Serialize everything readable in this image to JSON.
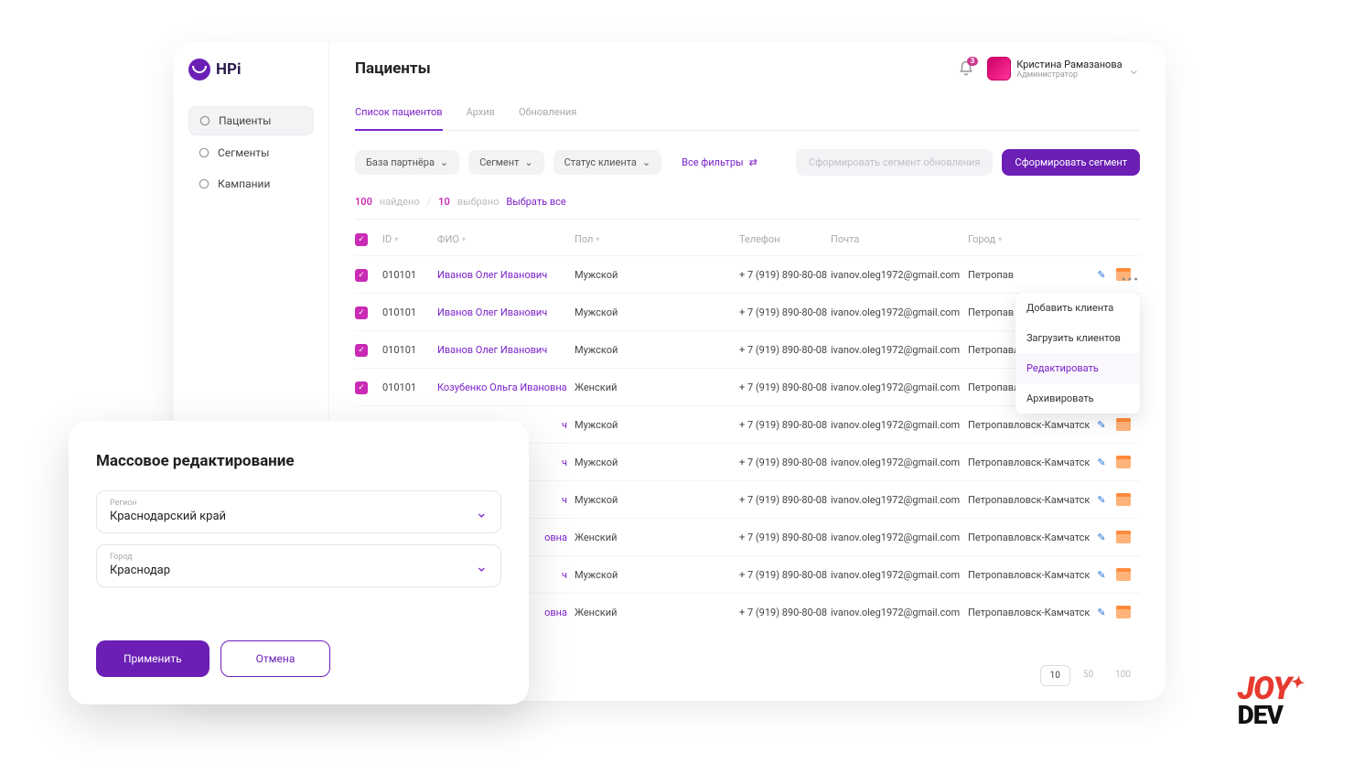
{
  "brand": "HPi",
  "sidebar": {
    "items": [
      {
        "label": "Пациенты",
        "active": true
      },
      {
        "label": "Сегменты",
        "active": false
      },
      {
        "label": "Кампании",
        "active": false
      }
    ]
  },
  "header": {
    "title": "Пациенты",
    "notifications": "3",
    "user_name": "Кристина Рамазанова",
    "user_role": "Администратор"
  },
  "tabs": [
    {
      "label": "Список пациентов",
      "active": true
    },
    {
      "label": "Архив",
      "active": false
    },
    {
      "label": "Обновления",
      "active": false
    }
  ],
  "filters": {
    "partner_base": "База партнёра",
    "segment": "Сегмент",
    "client_status": "Статус клиента",
    "all_filters": "Все фильтры",
    "disabled_btn": "Сформировать сегмент обновления",
    "primary_btn": "Сформировать сегмент"
  },
  "meta": {
    "found_count": "100",
    "found_label": "найдено",
    "selected_count": "10",
    "selected_label": "выбрано",
    "select_all": "Выбрать все"
  },
  "columns": {
    "id": "ID",
    "fio": "ФИО",
    "gender": "Пол",
    "phone": "Телефон",
    "email": "Почта",
    "city": "Город"
  },
  "rows": [
    {
      "checked": true,
      "id": "010101",
      "fio": "Иванов Олег Иванович",
      "gender": "Мужской",
      "phone": "+ 7 (919) 890-80-08",
      "email": "ivanov.oleg1972@gmail.com",
      "city": "Петропавловск-Камчатск"
    },
    {
      "checked": true,
      "id": "010101",
      "fio": "Иванов Олег Иванович",
      "gender": "Мужской",
      "phone": "+ 7 (919) 890-80-08",
      "email": "ivanov.oleg1972@gmail.com",
      "city": "Петропавловск-Камчатск"
    },
    {
      "checked": true,
      "id": "010101",
      "fio": "Иванов Олег Иванович",
      "gender": "Мужской",
      "phone": "+ 7 (919) 890-80-08",
      "email": "ivanov.oleg1972@gmail.com",
      "city": "Петропавловск-Камчатск"
    },
    {
      "checked": true,
      "id": "010101",
      "fio": "Козубенко Ольга Ивановна",
      "gender": "Женский",
      "phone": "+ 7 (919) 890-80-08",
      "email": "ivanov.oleg1972@gmail.com",
      "city": "Петропавловск-Камчатск"
    },
    {
      "checked": false,
      "id": "",
      "fio": "ч",
      "gender": "Мужской",
      "phone": "+ 7 (919) 890-80-08",
      "email": "ivanov.oleg1972@gmail.com",
      "city": "Петропавловск-Камчатск"
    },
    {
      "checked": false,
      "id": "",
      "fio": "ч",
      "gender": "Мужской",
      "phone": "+ 7 (919) 890-80-08",
      "email": "ivanov.oleg1972@gmail.com",
      "city": "Петропавловск-Камчатск"
    },
    {
      "checked": false,
      "id": "",
      "fio": "ч",
      "gender": "Мужской",
      "phone": "+ 7 (919) 890-80-08",
      "email": "ivanov.oleg1972@gmail.com",
      "city": "Петропавловск-Камчатск"
    },
    {
      "checked": false,
      "id": "",
      "fio": "овна",
      "gender": "Женский",
      "phone": "+ 7 (919) 890-80-08",
      "email": "ivanov.oleg1972@gmail.com",
      "city": "Петропавловск-Камчатск"
    },
    {
      "checked": false,
      "id": "",
      "fio": "ч",
      "gender": "Мужской",
      "phone": "+ 7 (919) 890-80-08",
      "email": "ivanov.oleg1972@gmail.com",
      "city": "Петропавловск-Камчатск"
    },
    {
      "checked": false,
      "id": "",
      "fio": "овна",
      "gender": "Женский",
      "phone": "+ 7 (919) 890-80-08",
      "email": "ivanov.oleg1972@gmail.com",
      "city": "Петропавловск-Камчатск"
    }
  ],
  "action_menu": [
    {
      "label": "Добавить клиента",
      "hover": false
    },
    {
      "label": "Загрузить клиентов",
      "hover": false
    },
    {
      "label": "Редактировать",
      "hover": true
    },
    {
      "label": "Архивировать",
      "hover": false
    }
  ],
  "pagination": {
    "options": [
      "10",
      "50",
      "100"
    ],
    "active": "10"
  },
  "modal": {
    "title": "Массовое редактирование",
    "region_label": "Регион",
    "region_value": "Краснодарский край",
    "city_label": "Город",
    "city_value": "Краснодар",
    "apply": "Применить",
    "cancel": "Отмена"
  },
  "watermark": {
    "line1": "JOY",
    "line2": "DEV"
  }
}
